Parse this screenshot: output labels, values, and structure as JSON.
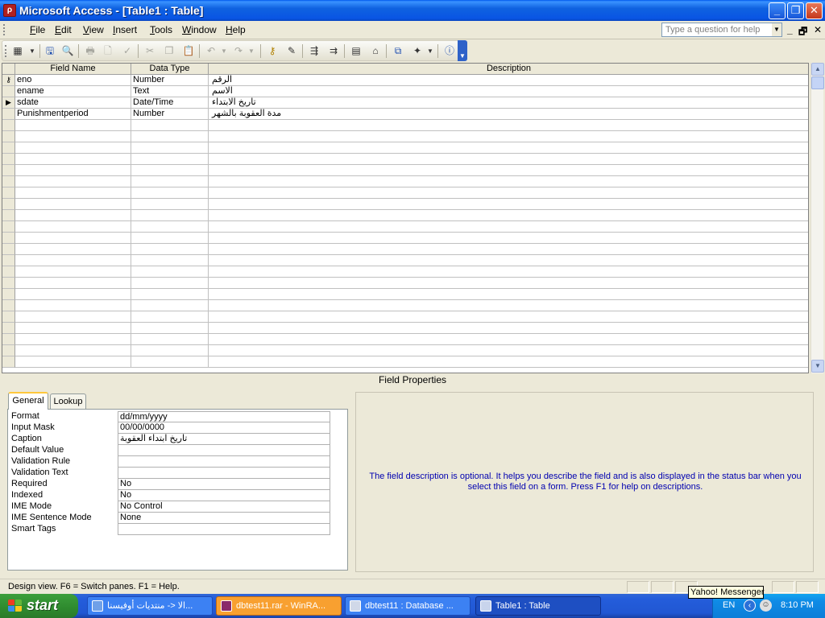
{
  "window": {
    "title": "Microsoft Access - [Table1 : Table]",
    "minimize": "_",
    "restore": "❐",
    "close": "✕"
  },
  "menu": {
    "items": [
      "File",
      "Edit",
      "View",
      "Insert",
      "Tools",
      "Window",
      "Help"
    ],
    "help_placeholder": "Type a question for help",
    "mdi_minimize": "_",
    "mdi_restore": "🗗",
    "mdi_close": "✕"
  },
  "toolbar": {
    "icons": [
      "view-icon",
      "save-icon",
      "search-icon",
      "print-icon",
      "print-preview-icon",
      "spelling-icon",
      "cut-icon",
      "copy-icon",
      "paste-icon",
      "undo-icon",
      "redo-icon",
      "primary-key-icon",
      "builder-icon",
      "insert-rows-icon",
      "delete-rows-icon",
      "properties-icon",
      "build-icon",
      "database-window-icon",
      "new-object-icon",
      "help-icon"
    ]
  },
  "grid": {
    "columns": [
      "Field Name",
      "Data Type",
      "Description"
    ],
    "rows": [
      {
        "field_name": "eno",
        "data_type": "Number",
        "description": "الرقم",
        "marker": "key"
      },
      {
        "field_name": "ename",
        "data_type": "Text",
        "description": "الاسم",
        "marker": ""
      },
      {
        "field_name": "sdate",
        "data_type": "Date/Time",
        "description": "تاريخ الابتداء",
        "marker": "current"
      },
      {
        "field_name": "Punishmentperiod",
        "data_type": "Number",
        "description": "مدة العقوبة بالشهر",
        "marker": ""
      }
    ],
    "empty_row_count": 22
  },
  "field_properties": {
    "title": "Field Properties",
    "tabs": [
      "General",
      "Lookup"
    ],
    "active_tab": "General",
    "properties": [
      {
        "label": "Format",
        "value": "dd/mm/yyyy"
      },
      {
        "label": "Input Mask",
        "value": "00/00/0000"
      },
      {
        "label": "Caption",
        "value": "تاريخ ابتداء العقوبة"
      },
      {
        "label": "Default Value",
        "value": ""
      },
      {
        "label": "Validation Rule",
        "value": ""
      },
      {
        "label": "Validation Text",
        "value": ""
      },
      {
        "label": "Required",
        "value": "No"
      },
      {
        "label": "Indexed",
        "value": "No"
      },
      {
        "label": "IME Mode",
        "value": "No Control"
      },
      {
        "label": "IME Sentence Mode",
        "value": "None"
      },
      {
        "label": "Smart Tags",
        "value": ""
      }
    ],
    "help_text": "The field description is optional.  It helps you describe the field and is also displayed in the status bar when you select this field on a form.  Press F1 for help on descriptions."
  },
  "status": {
    "text": "Design view.  F6 = Switch panes.  F1 = Help.",
    "tooltip": "Yahoo! Messenger"
  },
  "taskbar": {
    "start_label": "start",
    "tasks": [
      {
        "label": "الا <- منتديات أوفيسنا...",
        "style": "normal"
      },
      {
        "label": "dbtest11.rar - WinRA...",
        "style": "orange"
      },
      {
        "label": "dbtest11 : Database ...",
        "style": "normal"
      },
      {
        "label": "Table1 : Table",
        "style": "active"
      }
    ],
    "language": "EN",
    "clock": "8:10 PM"
  },
  "colors": {
    "titlebar": "#0955E4",
    "help_text": "#0000B0",
    "taskbar": "#245DDB",
    "start": "#2E8A2E"
  }
}
